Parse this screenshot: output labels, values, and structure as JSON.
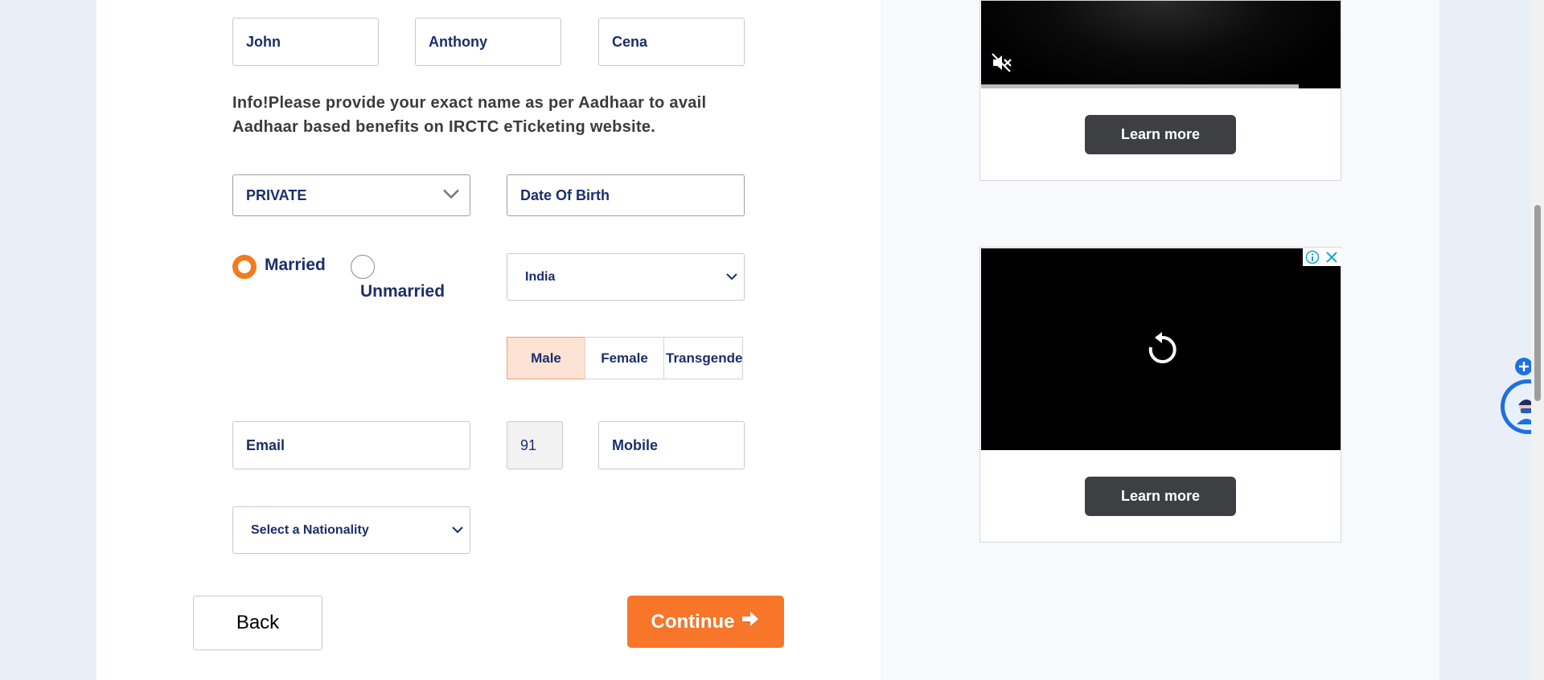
{
  "name": {
    "first": "John",
    "middle": "Anthony",
    "last": "Cena"
  },
  "info_text": "Info!Please provide your exact name as per Aadhaar to avail Aadhaar based benefits on IRCTC eTicketing website.",
  "occupation": {
    "value": "PRIVATE"
  },
  "dob": {
    "placeholder": "Date Of Birth"
  },
  "marital": {
    "married_label": "Married",
    "unmarried_label": "Unmarried",
    "selected": "Married"
  },
  "country": {
    "value": "India"
  },
  "gender": {
    "options": [
      "Male",
      "Female",
      "Transgender"
    ],
    "selected": "Male"
  },
  "contact": {
    "email_placeholder": "Email",
    "isd_code": "91",
    "mobile_placeholder": "Mobile"
  },
  "nationality": {
    "value": "Select a Nationality"
  },
  "buttons": {
    "back": "Back",
    "continue": "Continue"
  },
  "ads": {
    "learn_more_1": "Learn more",
    "learn_more_2": "Learn more"
  },
  "colors": {
    "accent": "#f7762a",
    "text_primary": "#1b2e6b",
    "ad_button": "#3d3f42"
  },
  "icons": [
    "chevron-down-icon",
    "mute-icon",
    "replay-icon",
    "info-icon",
    "close-icon",
    "arrow-right-icon",
    "plus-icon",
    "askdisha-avatar-icon"
  ]
}
